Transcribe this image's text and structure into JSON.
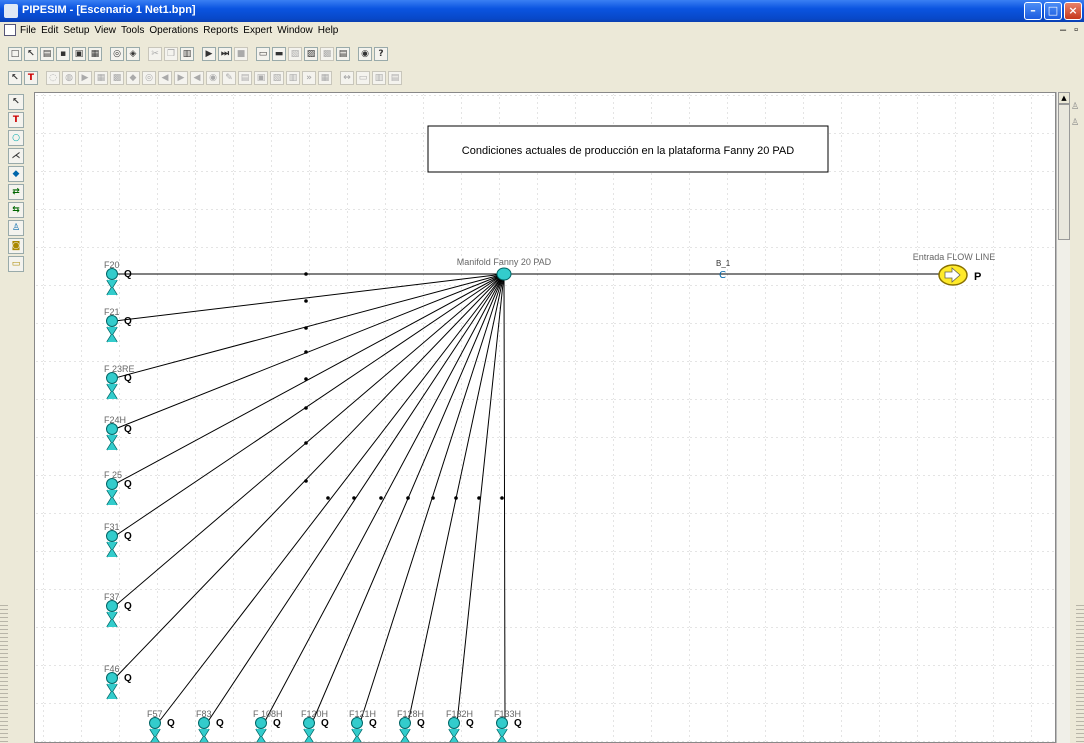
{
  "window": {
    "title": "PIPESIM - [Escenario 1 Net1.bpn]"
  },
  "menu": [
    "File",
    "Edit",
    "Setup",
    "View",
    "Tools",
    "Operations",
    "Reports",
    "Expert",
    "Window",
    "Help"
  ],
  "diagram": {
    "annotation": "Condiciones actuales de producción en la plataforma Fanny 20 PAD",
    "manifold_label": "Manifold Fanny 20 PAD",
    "node_label": "B_1",
    "sink_label": "Entrada FLOW LINE",
    "sink_tag": "P",
    "well_tag": "Q",
    "wells": [
      "F20",
      "F21",
      "F 23RE",
      "F24H",
      "F 25",
      "F31",
      "F37",
      "F46",
      "F57",
      "F83",
      "F 108H",
      "F120H",
      "F121H",
      "F128H",
      "F132H",
      "F133H"
    ]
  }
}
